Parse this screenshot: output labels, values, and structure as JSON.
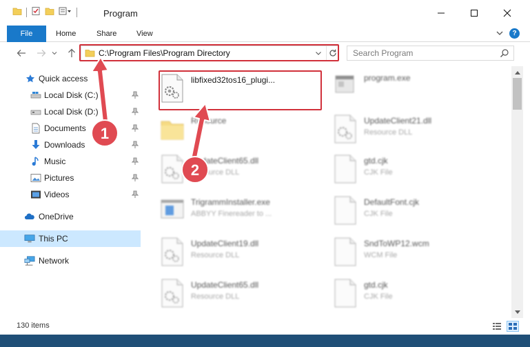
{
  "window": {
    "title": "Program",
    "minimize_icon": "minimize-icon",
    "maximize_icon": "maximize-icon",
    "close_icon": "close-icon"
  },
  "ribbon": {
    "tabs": [
      {
        "label": "File",
        "active": true
      },
      {
        "label": "Home"
      },
      {
        "label": "Share"
      },
      {
        "label": "View"
      }
    ],
    "help_label": "?"
  },
  "address": {
    "path": "C:\\Program Files\\Program Directory"
  },
  "search": {
    "placeholder": "Search Program"
  },
  "sidebar": {
    "items": [
      {
        "label": "Quick access",
        "icon": "star-icon"
      },
      {
        "label": "Local Disk (C:)",
        "icon": "drive-icon",
        "pinned": true
      },
      {
        "label": "Local Disk (D:)",
        "icon": "drive-icon",
        "pinned": true
      },
      {
        "label": "Documents",
        "icon": "documents-icon",
        "pinned": true
      },
      {
        "label": "Downloads",
        "icon": "download-icon",
        "pinned": true
      },
      {
        "label": "Music",
        "icon": "music-icon",
        "pinned": true
      },
      {
        "label": "Pictures",
        "icon": "pictures-icon",
        "pinned": true
      },
      {
        "label": "Videos",
        "icon": "videos-icon",
        "pinned": true
      },
      {
        "label": "OneDrive",
        "icon": "cloud-icon"
      },
      {
        "label": "This PC",
        "icon": "computer-icon",
        "selected": true
      },
      {
        "label": "Network",
        "icon": "network-icon"
      }
    ]
  },
  "files": [
    {
      "name": "libfixed32tos16_plugi...",
      "type": "",
      "icon": "gear-file-icon"
    },
    {
      "name": "program.exe",
      "type": "",
      "icon": "exe-icon"
    },
    {
      "name": "Resource",
      "type": "",
      "icon": "folder-icon"
    },
    {
      "name": "UpdateClient21.dll",
      "type": "Resource DLL",
      "icon": "gear-file-icon"
    },
    {
      "name": "UpdateClient65.dll",
      "type": "Resource DLL",
      "icon": "gear-file-icon"
    },
    {
      "name": "gtd.cjk",
      "type": "CJK File",
      "icon": "blank-file-icon"
    },
    {
      "name": "TrigrammInstaller.exe",
      "type": "ABBYY Finereader to ...",
      "icon": "app-icon"
    },
    {
      "name": "DefaultFont.cjk",
      "type": "CJK File",
      "icon": "blank-file-icon"
    },
    {
      "name": "UpdateClient19.dll",
      "type": "Resource DLL",
      "icon": "gear-file-icon"
    },
    {
      "name": "SndToWP12.wcm",
      "type": "WCM File",
      "icon": "blank-file-icon"
    },
    {
      "name": "UpdateClient65.dll",
      "type": "Resource DLL",
      "icon": "gear-file-icon"
    },
    {
      "name": "gtd.cjk",
      "type": "CJK File",
      "icon": "blank-file-icon"
    }
  ],
  "status": {
    "item_count": "130 items"
  },
  "annotations": {
    "step1": "1",
    "step2": "2",
    "color": "#e04a52"
  },
  "colors": {
    "accent": "#1979ca",
    "highlight": "#d1303a",
    "selected_bg": "#cce8ff"
  }
}
